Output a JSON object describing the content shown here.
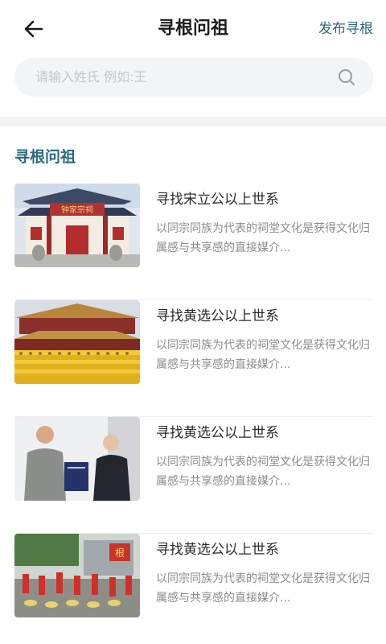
{
  "header": {
    "title": "寻根问祖",
    "publish_label": "发布寻根"
  },
  "search": {
    "placeholder": "请输入姓氏  例如:王"
  },
  "section": {
    "title": "寻根问祖"
  },
  "items": [
    {
      "title": "寻找宋立公以上世系",
      "desc": "以同宗同族为代表的祠堂文化是获得文化归属感与共享感的直接媒介...",
      "image": "ancestral-hall-photo",
      "plaque_text": "钟家宗祠"
    },
    {
      "title": "寻找黄选公以上世系",
      "desc": "以同宗同族为代表的祠堂文化是获得文化归属感与共享感的直接媒介...",
      "image": "choir-gathering-photo"
    },
    {
      "title": "寻找黄选公以上世系",
      "desc": "以同宗同族为代表的祠堂文化是获得文化归属感与共享感的直接媒介...",
      "image": "book-presentation-photo"
    },
    {
      "title": "寻找黄选公以上世系",
      "desc": "以同宗同族为代表的祠堂文化是获得文化归属感与共享感的直接媒介...",
      "image": "drum-performance-photo",
      "banner_text": "根"
    }
  ],
  "colors": {
    "accent": "#2c6a80",
    "search_bg": "#f3f4f6",
    "divider": "#f2f3f5"
  }
}
